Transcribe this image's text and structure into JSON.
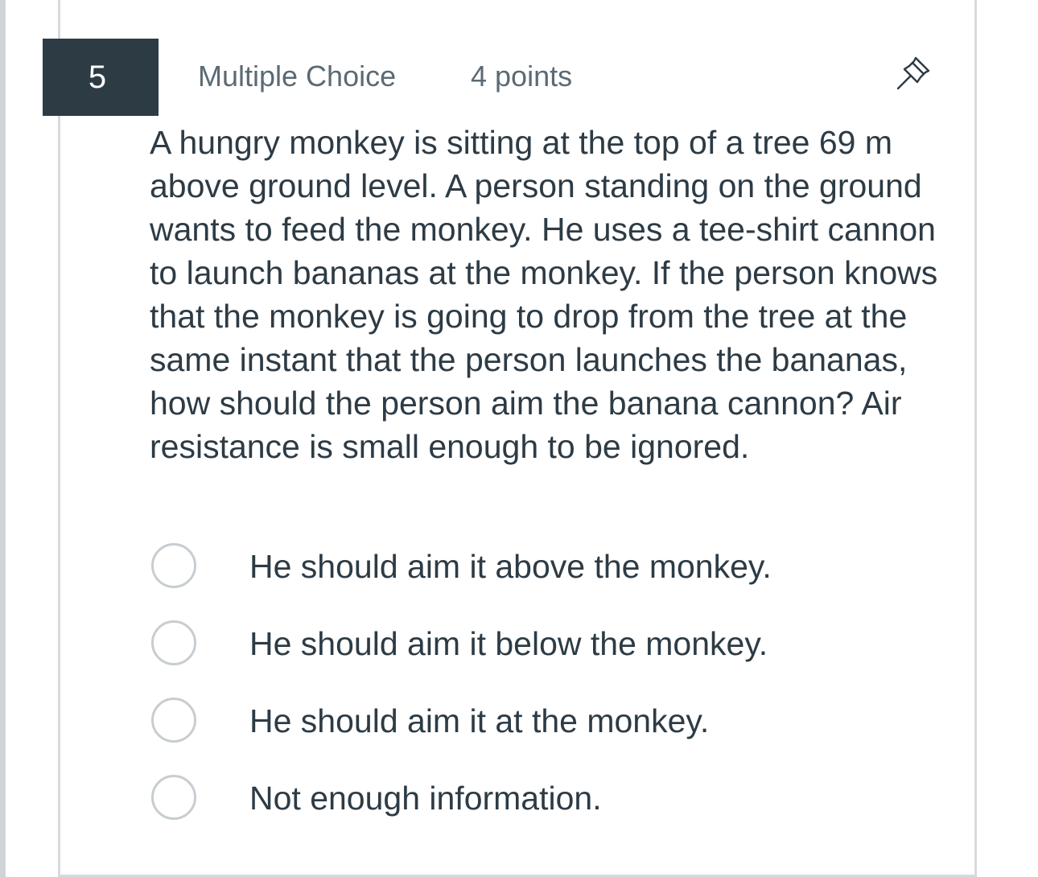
{
  "question": {
    "number": "5",
    "type": "Multiple Choice",
    "points": "4 points",
    "text": "A hungry monkey is sitting at the top of a tree 69 m above ground level. A person standing on the ground wants to feed the monkey. He uses a tee-shirt cannon to launch bananas at the monkey. If the person knows that the monkey is going to drop from the tree at the same instant that the person launches the bananas, how should the person aim the banana cannon? Air resistance is small enough to be ignored.",
    "pin_icon": "pin-icon",
    "answers": [
      {
        "label": "He should aim it above the monkey."
      },
      {
        "label": "He should aim it below the monkey."
      },
      {
        "label": "He should aim it at the monkey."
      },
      {
        "label": "Not enough information."
      }
    ]
  },
  "colors": {
    "number_badge_bg": "#2d3b45",
    "text": "#2d3b45",
    "meta_text": "#5b6a74",
    "radio_border": "#c7cdd1"
  }
}
